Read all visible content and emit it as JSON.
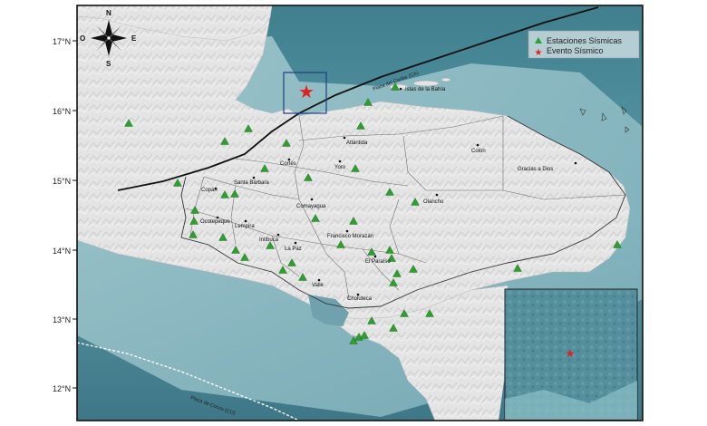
{
  "map": {
    "latitude_labels": [
      "17°N",
      "16°N",
      "15°N",
      "14°N",
      "13°N",
      "12°N"
    ],
    "compass": {
      "n": "N",
      "s": "S",
      "e": "E",
      "o": "O"
    },
    "legend": {
      "stations": "Estaciones Sísmicas",
      "event": "Evento Sísmico",
      "station_color": "#2e9e2e",
      "event_color": "#e02020"
    },
    "plates": {
      "north": "Placa del Caribe (CA)",
      "south": "Placa de Cocos (CO)"
    },
    "places": [
      "Islas de la Bahía",
      "Atlántida",
      "Colón",
      "Gracias a Dios",
      "Cortés",
      "Yoro",
      "Santa Bárbara",
      "Copán",
      "Olancho",
      "Comayagua",
      "Ocotepeque",
      "Lempira",
      "Intibucá",
      "La Paz",
      "Francisco Morazán",
      "El Paraíso",
      "Valle",
      "Choluteca"
    ],
    "colors": {
      "sea": "#4f8e9c",
      "land": "#e6e6e6"
    }
  }
}
